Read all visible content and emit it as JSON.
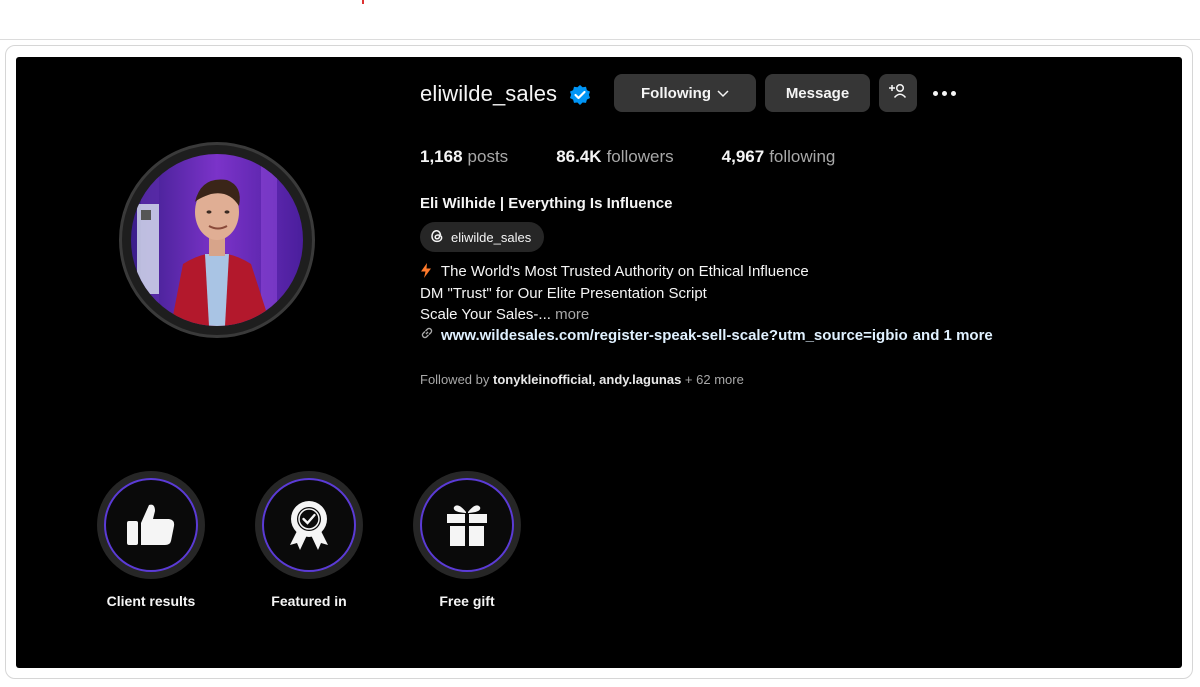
{
  "profile": {
    "username": "eliwilde_sales",
    "verified_icon": "verified-badge-icon",
    "buttons": {
      "following": "Following",
      "message": "Message",
      "add_user_icon": "add-user-icon",
      "more_icon": "more-options-icon"
    },
    "stats": {
      "posts_count": "1,168",
      "posts_label": "posts",
      "followers_count": "86.4K",
      "followers_label": "followers",
      "following_count": "4,967",
      "following_label": "following"
    },
    "full_name": "Eli Wilhide | Everything Is Influence",
    "threads_handle": "eliwilde_sales",
    "bio": {
      "line1": "The World's Most Trusted Authority on Ethical Influence",
      "line2": "DM \"Trust\" for Our Elite Presentation Script",
      "line3": "Scale Your Sales-...",
      "more": "more"
    },
    "link": {
      "url": "www.wildesales.com/register-speak-sell-scale?utm_source=igbio",
      "extra": "and 1 more"
    },
    "followed_by": {
      "prefix": "Followed by",
      "users": "tonykleinofficial, andy.lagunas",
      "suffix": "+ 62 more"
    }
  },
  "highlights": [
    {
      "label": "Client results",
      "icon": "thumbs-up-icon"
    },
    {
      "label": "Featured in",
      "icon": "award-badge-icon"
    },
    {
      "label": "Free gift",
      "icon": "gift-icon"
    }
  ],
  "colors": {
    "background": "#000000",
    "button": "#363636",
    "highlight_ring": "#5b3bd6",
    "verified": "#0095f6",
    "link": "#e0f1ff",
    "muted": "#a8a8a8"
  }
}
